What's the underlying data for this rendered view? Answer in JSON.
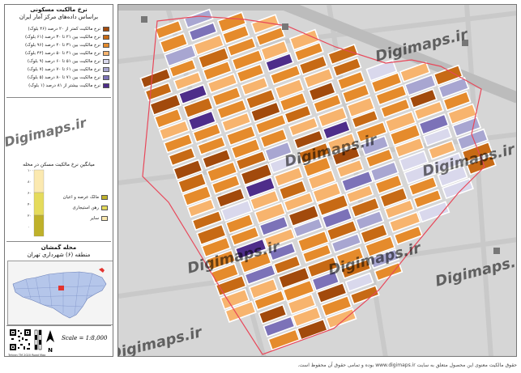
{
  "legend": {
    "title_line1": "نرخ مالکیت مسکونی",
    "title_line2": "براساس داده‌های مرکز آمار ایران",
    "items": [
      {
        "label": "نرخ مالکیت کمتر از ۲۰ درصد (۴۶ بلوک)",
        "color": "#a24a0c"
      },
      {
        "label": "نرخ مالکیت بین ۲۱ تا ۳۰ درصد (۶۱ بلوک)",
        "color": "#c76a15"
      },
      {
        "label": "نرخ مالکیت بین ۳۱ تا ۴۰ درصد (۹۶ بلوک)",
        "color": "#e58b2c"
      },
      {
        "label": "نرخ مالکیت بین ۴۱ تا ۵۰ درصد (۴۲ بلوک)",
        "color": "#f7b46e"
      },
      {
        "label": "نرخ مالکیت بین ۵۱ تا ۶۰ درصد (۹ بلوک)",
        "color": "#d9d8ec"
      },
      {
        "label": "نرخ مالکیت بین ۶۱ تا ۷۰ درصد (۷ بلوک)",
        "color": "#a8a6d1"
      },
      {
        "label": "نرخ مالکیت بین ۷۱ تا ۸۰ درصد (۵ بلوک)",
        "color": "#7c72b8"
      },
      {
        "label": "نرخ مالکیت بیشتر از ۸۱ درصد (۱ بلوک)",
        "color": "#4e2d8a"
      }
    ]
  },
  "chart": {
    "title": "میانگین نرخ مالکیت مسکن در محله",
    "segments": [
      {
        "label": "مالک عرصه و اعیان",
        "color": "#bfb12a"
      },
      {
        "label": "رهن استیجاری",
        "color": "#e5db5c"
      },
      {
        "label": "سایر",
        "color": "#fbe9b0"
      }
    ],
    "ticks": [
      "۱۰۰",
      "۸۰",
      "۶۰",
      "۴۰",
      "۲۰",
      "۰"
    ]
  },
  "place": {
    "line1": "محله گمشان",
    "line2": "منطقه (۶) شهرداری تهران"
  },
  "scale_label": "Scale = 1:8,000",
  "north_label": "N",
  "watermark": "Digimaps.ir",
  "footer": "حقوق مالکیت معنوی این محصول متعلق به سایت www.digimaps.ir بوده و تمامی حقوق آن محفوظ است.",
  "sidebar_footer_text": "Tehran TM 2020 Road Map"
}
